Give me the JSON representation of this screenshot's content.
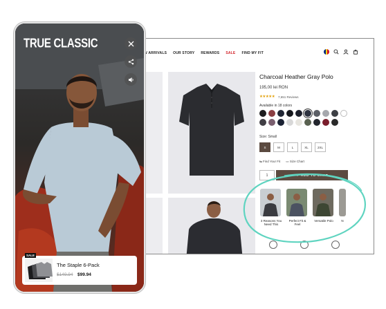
{
  "desktop": {
    "nav": {
      "links": [
        "W ARRIVALS",
        "OUR STORY",
        "REWARDS",
        "SALE",
        "FIND MY FIT"
      ],
      "sale_color": "#d2232a"
    },
    "product": {
      "title": "Charcoal Heather Gray Polo",
      "price": "195,00 lei RON",
      "rating_stars": "★★★★★",
      "reviews": "7,651 Reviews",
      "available": "Available in 18 colors",
      "swatches": [
        "#1d1d1f",
        "#8a3e42",
        "#202634",
        "#16181d",
        "#1c1f2a",
        "#2e3340",
        "#5c5f66",
        "#a6a8ad",
        "#3d3f44",
        "#ffffff",
        "#403e44",
        "#7a5f6f",
        "#1b2233",
        "#d8d8d8",
        "#e7e5df",
        "#596150",
        "#23262e",
        "#7a1e2c",
        "#2a2a2a"
      ],
      "size_label": "Size: Small",
      "sizes": [
        "S",
        "M",
        "L",
        "XL",
        "2XL"
      ],
      "selected_size": "S",
      "find_fit": "Find Your Fit",
      "size_chart": "Size Chart",
      "qty": "1",
      "add_to_cart": "ADD TO CART",
      "accent": "#5b4a40"
    },
    "videos": [
      {
        "caption": "3 Reasons You Need This"
      },
      {
        "caption": "Perfect Fit & Feel"
      },
      {
        "caption": "Versatile Polo"
      },
      {
        "caption": "N"
      }
    ],
    "highlight_color": "#5fd4c0"
  },
  "phone": {
    "brand": "TRUE CLASSIC",
    "product_card": {
      "badge": "SALE",
      "name": "The Staple 6-Pack",
      "old_price": "$149.94",
      "new_price": "$99.94"
    }
  }
}
